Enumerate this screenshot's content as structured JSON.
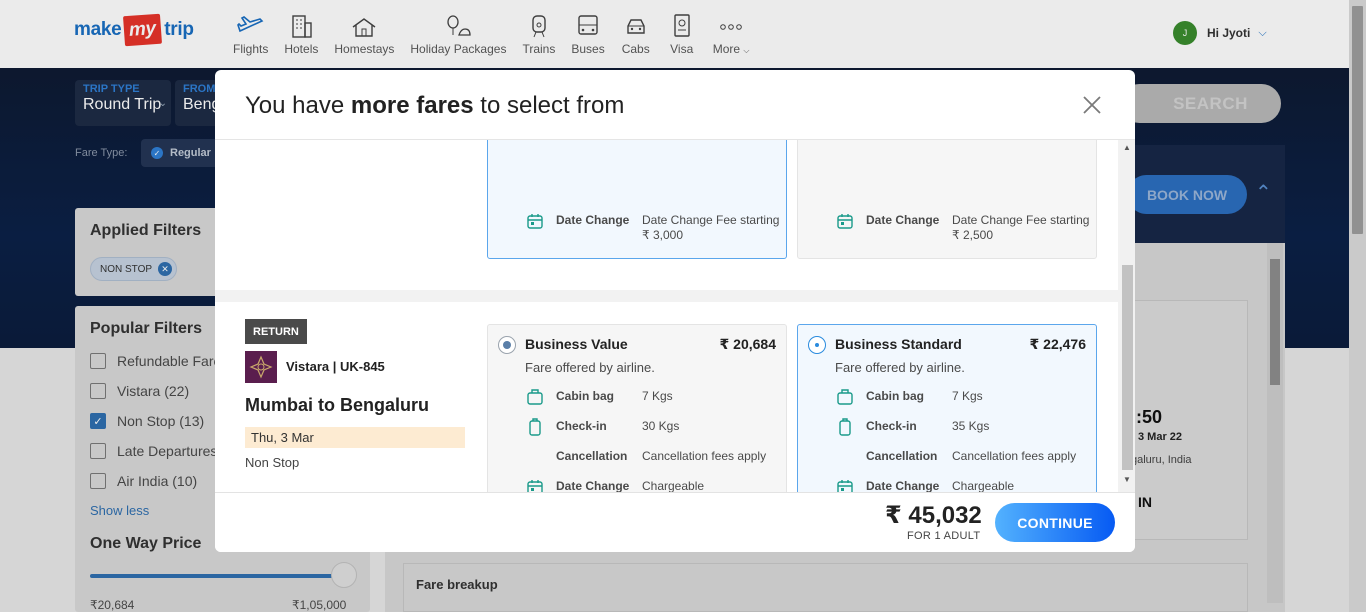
{
  "nav": {
    "logo": {
      "make": "make",
      "my": "my",
      "trip": "trip"
    },
    "items": [
      {
        "label": "Flights",
        "icon": "plane-icon"
      },
      {
        "label": "Hotels",
        "icon": "hotel-icon"
      },
      {
        "label": "Homestays",
        "icon": "home-icon"
      },
      {
        "label": "Holiday Packages",
        "icon": "holiday-icon"
      },
      {
        "label": "Trains",
        "icon": "train-icon"
      },
      {
        "label": "Buses",
        "icon": "bus-icon"
      },
      {
        "label": "Cabs",
        "icon": "cab-icon"
      },
      {
        "label": "Visa",
        "icon": "visa-icon"
      },
      {
        "label": "More",
        "icon": "more-icon"
      }
    ],
    "user": {
      "initial": "J",
      "greeting": "Hi Jyoti"
    }
  },
  "search": {
    "trip_type_label": "TRIP TYPE",
    "trip_type_value": "Round Trip",
    "from_label": "FROM",
    "from_value": "Beng",
    "fare_type_label": "Fare Type:",
    "fare_type_value": "Regular",
    "search_button": "SEARCH"
  },
  "filters": {
    "applied_title": "Applied Filters",
    "applied_chip": "NON STOP",
    "popular_title": "Popular Filters",
    "items": [
      {
        "label": "Refundable Fares",
        "checked": false
      },
      {
        "label": "Vistara (22)",
        "checked": false
      },
      {
        "label": "Non Stop (13)",
        "checked": true
      },
      {
        "label": "Late Departures",
        "checked": false
      },
      {
        "label": "Air India (10)",
        "checked": false
      }
    ],
    "show_less": "Show less",
    "price_title": "One Way Price",
    "price_min": "₹20,684",
    "price_max": "₹1,05,000"
  },
  "background": {
    "book_now": "BOOK NOW",
    "time": ":50",
    "date": "3 Mar 22",
    "city": "galuru, India",
    "code": "IN",
    "fare_breakup": "Fare breakup"
  },
  "modal": {
    "title_prefix": "You have ",
    "title_bold": "more fares",
    "title_suffix": " to select from",
    "top_section": {
      "fares": [
        {
          "key": "Date Change",
          "value": "Date Change Fee starting",
          "value2": "₹ 3,000"
        },
        {
          "key": "Date Change",
          "value": "Date Change Fee starting",
          "value2": "₹ 2,500"
        }
      ]
    },
    "return": {
      "badge": "RETURN",
      "airline": "Vistara | UK-845",
      "route": "Mumbai to Bengaluru",
      "date": "Thu, 3 Mar",
      "stops": "Non Stop",
      "fares": [
        {
          "name": "Business Value",
          "price": "₹ 20,684",
          "offer": "Fare offered by airline.",
          "selected": true,
          "rows": [
            {
              "key": "Cabin bag",
              "value": "7 Kgs"
            },
            {
              "key": "Check-in",
              "value": "30 Kgs"
            },
            {
              "key": "Cancellation",
              "value": "Cancellation fees apply"
            },
            {
              "key": "Date Change",
              "value": "Chargeable"
            }
          ]
        },
        {
          "name": "Business Standard",
          "price": "₹ 22,476",
          "offer": "Fare offered by airline.",
          "selected": false,
          "rows": [
            {
              "key": "Cabin bag",
              "value": "7 Kgs"
            },
            {
              "key": "Check-in",
              "value": "35 Kgs"
            },
            {
              "key": "Cancellation",
              "value": "Cancellation fees apply"
            },
            {
              "key": "Date Change",
              "value": "Chargeable"
            }
          ]
        }
      ]
    },
    "footer": {
      "total": "₹ 45,032",
      "for_adult": "FOR 1 ADULT",
      "continue": "CONTINUE"
    }
  },
  "colors": {
    "brand_blue": "#1a6fc4",
    "brand_red": "#e8332a",
    "accent_blue": "#2a8bde",
    "date_band": "#fdebd2"
  }
}
